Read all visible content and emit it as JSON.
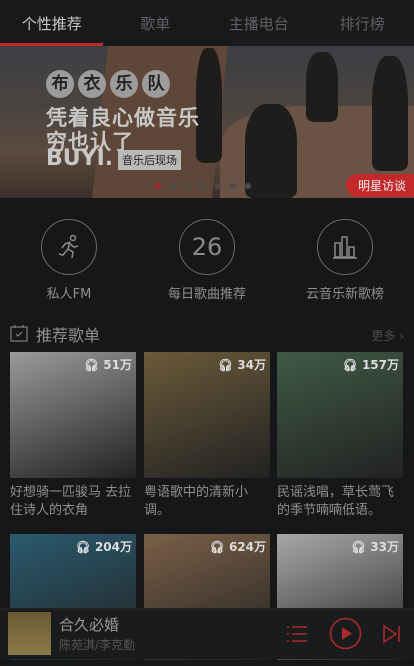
{
  "tabs": [
    {
      "label": "个性推荐"
    },
    {
      "label": "歌单"
    },
    {
      "label": "主播电台"
    },
    {
      "label": "排行榜"
    }
  ],
  "banner": {
    "title_chars": [
      "布",
      "衣",
      "乐",
      "队"
    ],
    "line1": "凭着良心做音乐",
    "line2": "穷也认了",
    "brand": "BUYI.",
    "tag": "音乐后现场",
    "badge": "明星访谈",
    "slide_count": 7,
    "active_slide": 0
  },
  "shortcuts": [
    {
      "label": "私人FM",
      "icon": "running-person-icon"
    },
    {
      "label": "每日歌曲推荐",
      "icon": "calendar-day-icon",
      "day": "26"
    },
    {
      "label": "云音乐新歌榜",
      "icon": "bar-chart-icon"
    }
  ],
  "section": {
    "title": "推荐歌单",
    "more": "更多"
  },
  "playlists": [
    {
      "count": "51万",
      "title": "好想骑一匹骏马 去拉住诗人的衣角",
      "color": "#9a9a98"
    },
    {
      "count": "34万",
      "title": "粤语歌中的清新小调。",
      "color": "#6b5a3a"
    },
    {
      "count": "157万",
      "title": "民谣浅唱，草长莺飞的季节喃喃低语。",
      "color": "#3f5a45"
    },
    {
      "count": "204万",
      "title": "",
      "color": "#2a5a6e"
    },
    {
      "count": "624万",
      "title": "",
      "color": "#7a6048"
    },
    {
      "count": "33万",
      "title": "",
      "color": "#a8a8a8"
    }
  ],
  "player": {
    "song": "合久必婚",
    "artist": "陈苑淇/李克勤"
  }
}
